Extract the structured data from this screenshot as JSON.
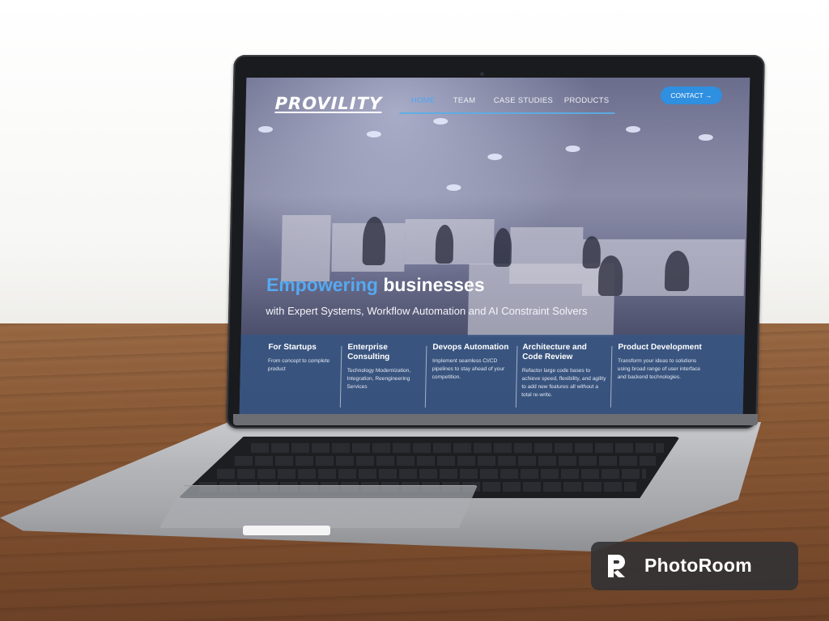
{
  "site": {
    "logo": "PROVILITY",
    "nav": [
      {
        "label": "HOME",
        "active": true
      },
      {
        "label": "TEAM",
        "active": false
      },
      {
        "label": "CASE STUDIES",
        "active": false
      },
      {
        "label": "PRODUCTS",
        "active": false
      }
    ],
    "contact_label": "CONTACT →",
    "hero": {
      "title_accent": "Empowering",
      "title_rest": " businesses",
      "subtitle": "with Expert Systems, Workflow Automation and AI Constraint Solvers"
    },
    "services": [
      {
        "title": "For Startups",
        "desc": "From concept to complete product"
      },
      {
        "title": "Enterprise Consulting",
        "desc": "Technology Modernization, Integration, Reengineering Services"
      },
      {
        "title": "Devops Automation",
        "desc": "Implement seamless CI/CD pipelines to stay ahead of your competition."
      },
      {
        "title": "Architecture and Code Review",
        "desc": "Refactor large code bases to achieve speed, flexibility, and agility to add new features all without a total re-write."
      },
      {
        "title": "Product Development",
        "desc": "Transform your ideas to solutions using broad range of user interface and backend technologies."
      }
    ]
  },
  "watermark": {
    "label": "PhotoRoom"
  },
  "colors": {
    "accent": "#56a9f0",
    "contact_button": "#2f8fe0",
    "services_band": "#375582",
    "table_wood": "#8a5a37"
  }
}
